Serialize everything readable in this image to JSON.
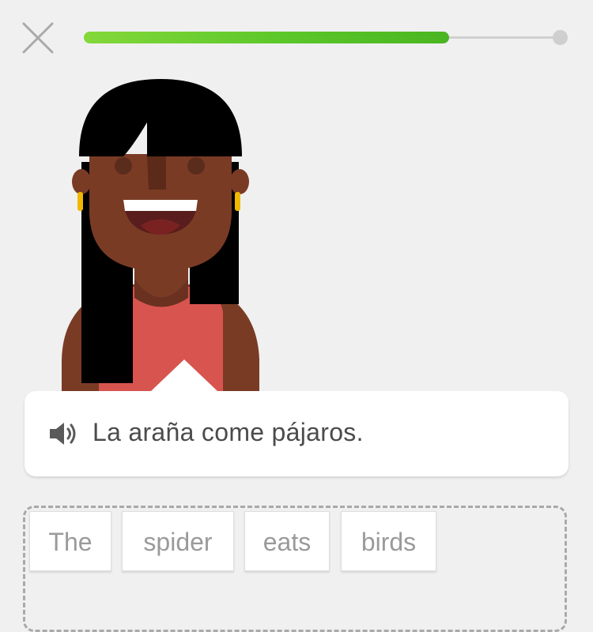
{
  "header": {
    "close_icon": "close-icon",
    "progress_fraction": 0.77,
    "progress_color": "#58c72a"
  },
  "character": {
    "icon": "woman-avatar-illustration"
  },
  "prompt": {
    "speaker_icon": "speaker-icon",
    "text": "La araña come pájaros."
  },
  "answer": {
    "words": [
      "The",
      "spider",
      "eats",
      "birds"
    ]
  }
}
